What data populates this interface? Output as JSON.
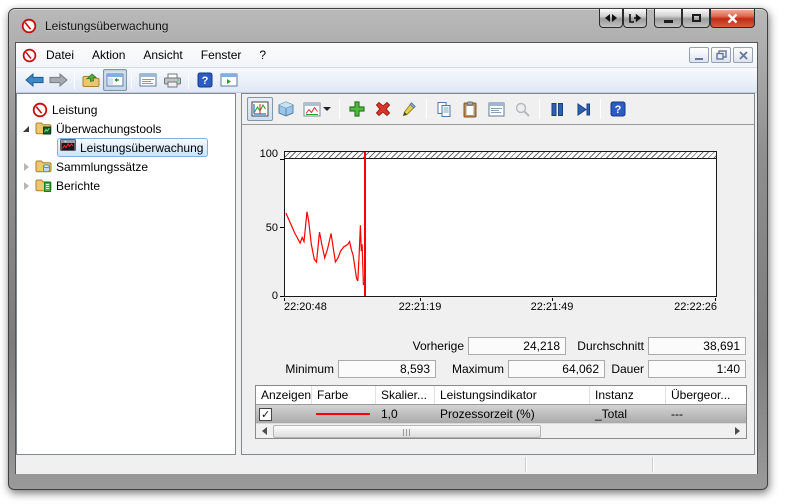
{
  "window": {
    "title": "Leistungsüberwachung"
  },
  "menubar": {
    "items": [
      "Datei",
      "Aktion",
      "Ansicht",
      "Fenster",
      "?"
    ]
  },
  "tree": {
    "root": "Leistung",
    "items": [
      {
        "label": "Überwachungstools",
        "state": "expanded"
      },
      {
        "label": "Leistungsüberwachung",
        "selected": true
      },
      {
        "label": "Sammlungssätze",
        "state": "collapsed"
      },
      {
        "label": "Berichte",
        "state": "collapsed"
      }
    ]
  },
  "chart_data": {
    "type": "line",
    "title": "",
    "xlabel": "",
    "ylabel": "",
    "ylim": [
      0,
      100
    ],
    "grid": false,
    "yticks": [
      "100",
      "50",
      "0"
    ],
    "xticks": [
      "22:20:48",
      "22:21:19",
      "22:21:49",
      "22:22:26"
    ],
    "xtick_positions": [
      0,
      0.316,
      0.622,
      1.0
    ],
    "series": [
      {
        "name": "Prozessorzeit (%)",
        "color": "#ff0000",
        "points": [
          [
            0.002,
            61
          ],
          [
            0.009,
            56
          ],
          [
            0.016,
            51
          ],
          [
            0.023,
            46
          ],
          [
            0.03,
            42
          ],
          [
            0.035,
            39
          ],
          [
            0.04,
            43
          ],
          [
            0.044,
            40
          ],
          [
            0.051,
            62
          ],
          [
            0.055,
            55
          ],
          [
            0.061,
            38
          ],
          [
            0.068,
            27
          ],
          [
            0.073,
            25
          ],
          [
            0.08,
            47
          ],
          [
            0.086,
            37
          ],
          [
            0.092,
            28
          ],
          [
            0.099,
            35
          ],
          [
            0.107,
            46
          ],
          [
            0.112,
            35
          ],
          [
            0.117,
            25
          ],
          [
            0.123,
            28
          ],
          [
            0.129,
            33
          ],
          [
            0.136,
            36
          ],
          [
            0.141,
            37
          ],
          [
            0.146,
            38
          ],
          [
            0.15,
            40
          ],
          [
            0.154,
            34
          ],
          [
            0.158,
            30
          ],
          [
            0.163,
            19
          ],
          [
            0.166,
            13
          ],
          [
            0.169,
            11
          ],
          [
            0.172,
            30
          ],
          [
            0.175,
            52
          ],
          [
            0.177,
            33
          ],
          [
            0.179,
            38
          ],
          [
            0.182,
            8
          ]
        ]
      }
    ],
    "current_position_marker_x": 0.184
  },
  "stats": {
    "vorherige": {
      "label": "Vorherige",
      "value": "24,218"
    },
    "durchschnitt": {
      "label": "Durchschnitt",
      "value": "38,691"
    },
    "minimum": {
      "label": "Minimum",
      "value": "8,593"
    },
    "maximum": {
      "label": "Maximum",
      "value": "64,062"
    },
    "dauer": {
      "label": "Dauer",
      "value": "1:40"
    }
  },
  "counter_table": {
    "headers": [
      "Anzeigen",
      "Farbe",
      "Skalier...",
      "Leistungsindikator",
      "Instanz",
      "Übergeor..."
    ],
    "rows": [
      {
        "checked": true,
        "color": "#ff0000",
        "scale": "1,0",
        "counter": "Prozessorzeit (%)",
        "instance": "_Total",
        "parent": "---"
      }
    ]
  }
}
